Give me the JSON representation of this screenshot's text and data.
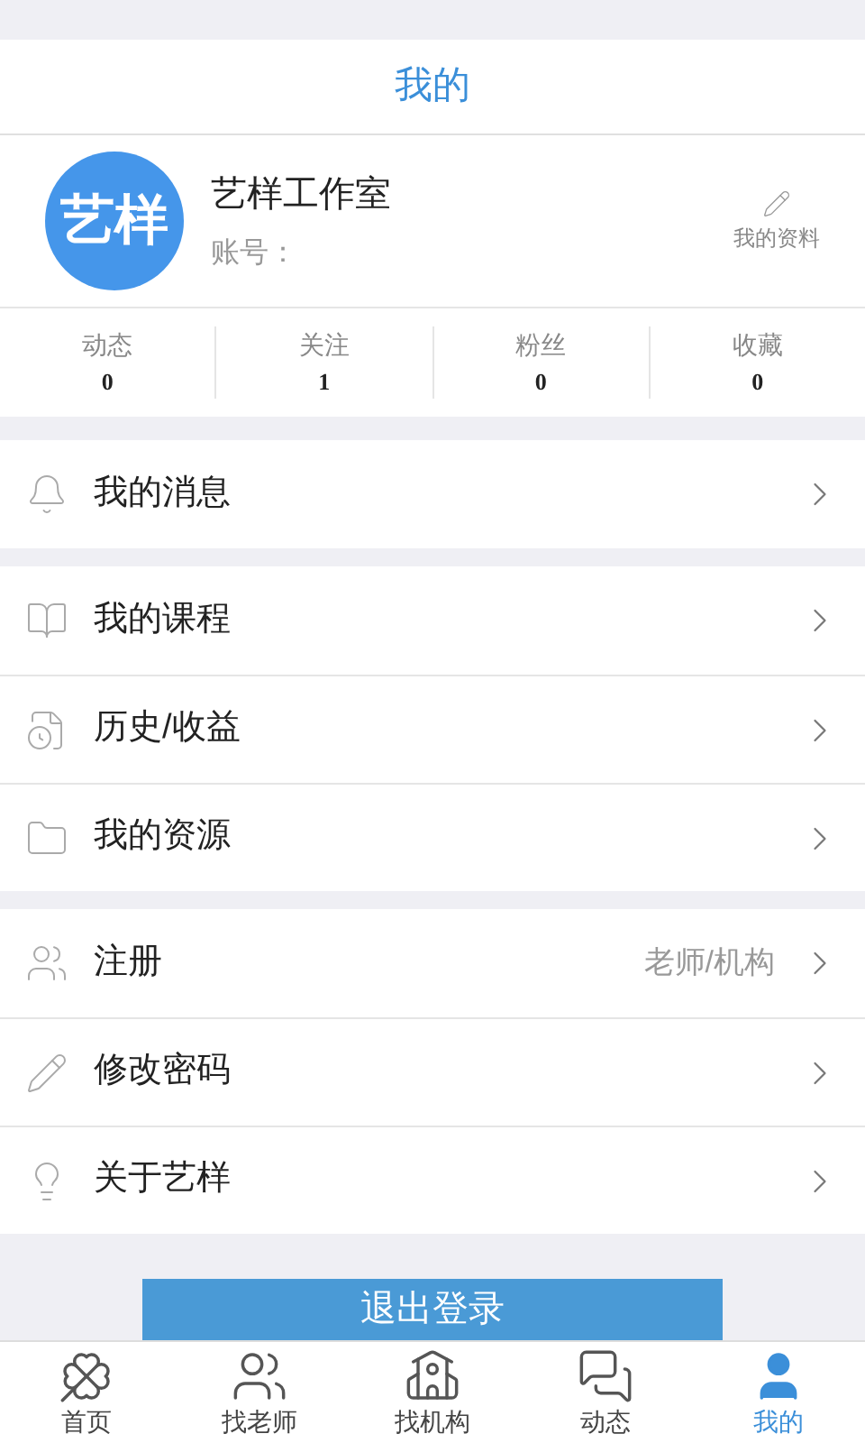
{
  "header": {
    "title": "我的"
  },
  "profile": {
    "avatar_text": "艺样",
    "name": "艺样工作室",
    "account_label": "账号：",
    "edit_label": "我的资料"
  },
  "stats": [
    {
      "label": "动态",
      "value": "0"
    },
    {
      "label": "关注",
      "value": "1"
    },
    {
      "label": "粉丝",
      "value": "0"
    },
    {
      "label": "收藏",
      "value": "0"
    }
  ],
  "menu_groups": [
    [
      {
        "kind": "bell",
        "label": "我的消息"
      }
    ],
    [
      {
        "kind": "book",
        "label": "我的课程"
      },
      {
        "kind": "history",
        "label": "历史/收益"
      },
      {
        "kind": "folder",
        "label": "我的资源"
      }
    ],
    [
      {
        "kind": "register",
        "label": "注册",
        "hint": "老师/机构"
      },
      {
        "kind": "pencil",
        "label": "修改密码"
      },
      {
        "kind": "bulb",
        "label": "关于艺样"
      }
    ]
  ],
  "logout_button": "退出登录",
  "tab_bar": [
    {
      "kind": "home",
      "label": "首页",
      "selected": false
    },
    {
      "kind": "teachers",
      "label": "找老师",
      "selected": false
    },
    {
      "kind": "school",
      "label": "找机构",
      "selected": false
    },
    {
      "kind": "chat",
      "label": "动态",
      "selected": false
    },
    {
      "kind": "me",
      "label": "我的",
      "selected": true
    }
  ]
}
